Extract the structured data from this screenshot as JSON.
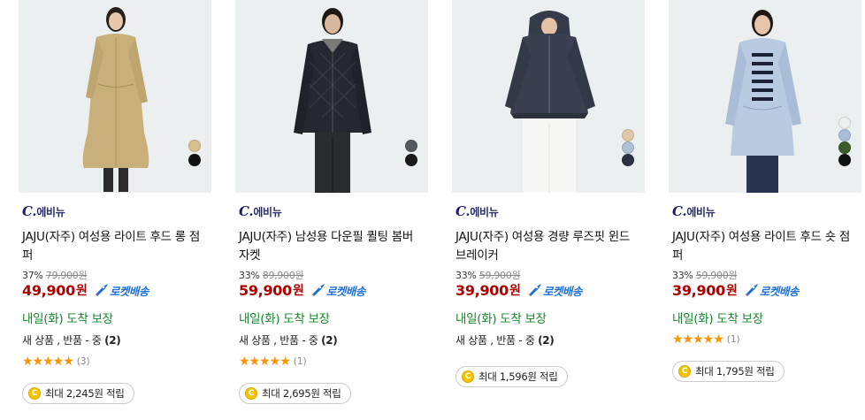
{
  "products": [
    {
      "brand": "에비뉴",
      "title": "JAJU(자주) 여성용 라이트 후드 롱 점퍼",
      "discount": "37%",
      "original_price": "79,900원",
      "price": "49,900",
      "price_unit": "원",
      "delivery_badge": "로켓배송",
      "arrival": "내일(화) 도착 보장",
      "review_note": "새 상품 , 반품 - 중",
      "review_note_count": "(2)",
      "stars": "★★★★★",
      "rating": 5,
      "review_count": "(3)",
      "reward_icon": "C",
      "reward": "최대 2,245원 적립",
      "swatches": [
        "#d8bf8e",
        "#111111"
      ]
    },
    {
      "brand": "에비뉴",
      "title": "JAJU(자주) 남성용 다운필 퀼팅 봄버 자켓",
      "discount": "33%",
      "original_price": "89,900원",
      "price": "59,900",
      "price_unit": "원",
      "delivery_badge": "로켓배송",
      "arrival": "내일(화) 도착 보장",
      "review_note": "새 상품 , 반품 - 중",
      "review_note_count": "(2)",
      "stars": "★★★★★",
      "rating": 5,
      "review_count": "(1)",
      "reward_icon": "C",
      "reward": "최대 2,695원 적립",
      "swatches": [
        "#555a5e",
        "#1a1a1a"
      ]
    },
    {
      "brand": "에비뉴",
      "title": "JAJU(자주) 여성용 경량 루즈핏 윈드 브레이커",
      "discount": "33%",
      "original_price": "59,900원",
      "price": "39,900",
      "price_unit": "원",
      "delivery_badge": "로켓배송",
      "arrival": "내일(화) 도착 보장",
      "review_note": "새 상품 , 반품 - 중",
      "review_note_count": "(2)",
      "reward_icon": "C",
      "reward": "최대 1,596원 적립",
      "swatches": [
        "#e0c8a6",
        "#aebfd6",
        "#2c3340"
      ]
    },
    {
      "brand": "에비뉴",
      "title": "JAJU(자주) 여성용 라이트 후드 숏 점퍼",
      "discount": "33%",
      "original_price": "59,900원",
      "price": "39,900",
      "price_unit": "원",
      "delivery_badge": "로켓배송",
      "arrival": "내일(화) 도착 보장",
      "stars": "★★★★★",
      "rating": 5,
      "review_count": "(1)",
      "reward_icon": "C",
      "reward": "최대 1,795원 적립",
      "swatches": [
        "#eeeeee",
        "#a9bdd6",
        "#3c5a2c",
        "#111111"
      ]
    }
  ],
  "colors": {
    "price": "#ae0000",
    "rocket": "#1c6fd8",
    "arrival": "#14862c",
    "star": "#ff9200",
    "brand": "#1c1c6e"
  },
  "icons": {
    "brand_logo": "c-avenue-logo",
    "rocket": "rocket-icon",
    "reward": "coin-icon"
  }
}
